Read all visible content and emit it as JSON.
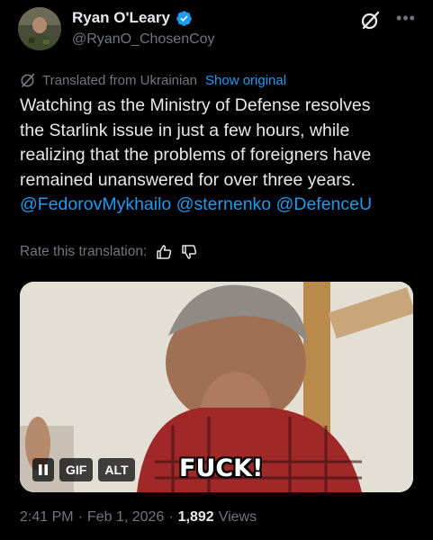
{
  "author": {
    "name": "Ryan O'Leary",
    "handle": "@RyanO_ChosenCoy",
    "verified": true
  },
  "translation": {
    "notice": "Translated from Ukrainian",
    "show_original": "Show original",
    "rate_label": "Rate this translation:"
  },
  "tweet": {
    "text_lines": [
      "Watching as the Ministry of Defense resolves",
      "the Starlink issue in just a few hours, while",
      "realizing that the problems of foreigners have",
      "remained unanswered for over three years."
    ],
    "mentions": [
      "@FedorovMykhailo",
      "@sternenko",
      "@DefenceU"
    ]
  },
  "media": {
    "gif_label": "GIF",
    "alt_label": "ALT",
    "caption": "FUCK!"
  },
  "meta": {
    "time": "2:41 PM",
    "separator": "·",
    "date": "Feb 1, 2026",
    "views_count": "1,892",
    "views_label": "Views"
  },
  "icons": {
    "verified": "verified-badge-icon",
    "grok": "grok-icon",
    "more": "more-icon",
    "translate": "translate-icon",
    "thumbs_up": "thumbs-up-icon",
    "thumbs_down": "thumbs-down-icon",
    "pause": "pause-icon"
  },
  "colors": {
    "background": "#000000",
    "text": "#e7e9ea",
    "secondary": "#71767b",
    "accent": "#1d9bf0"
  }
}
